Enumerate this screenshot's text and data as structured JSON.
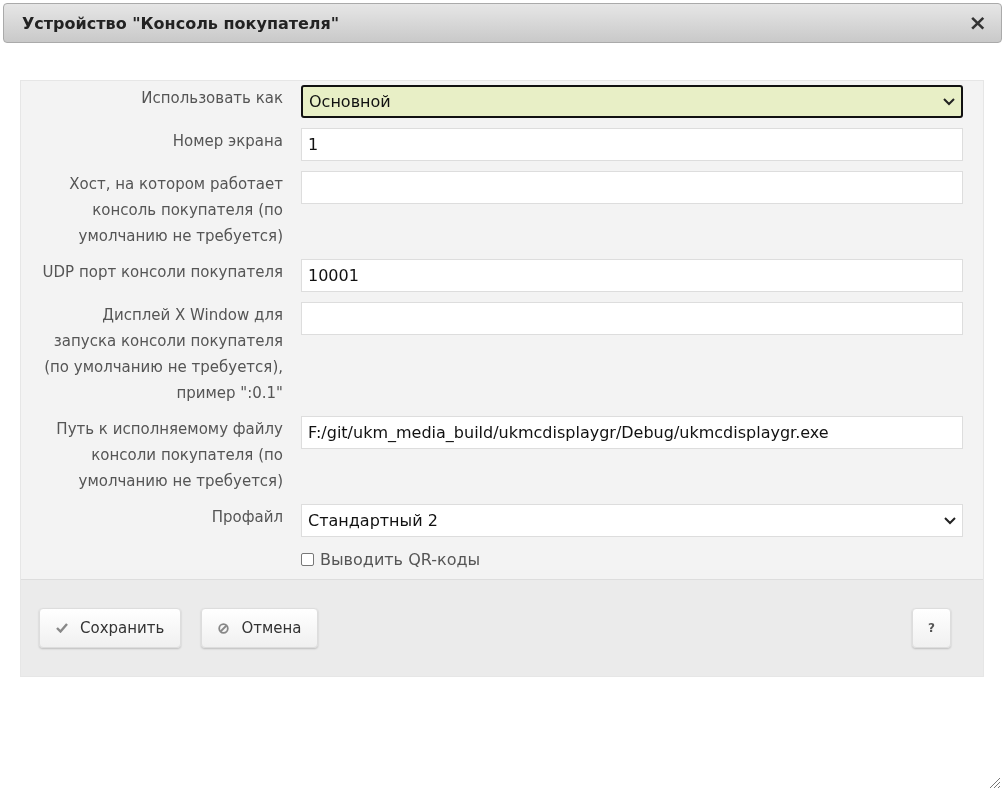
{
  "dialog": {
    "title": "Устройство \"Консоль покупателя\"",
    "close": "×"
  },
  "fields": [
    {
      "kind": "select",
      "label": "Использовать как",
      "value": "Основной",
      "focused": true
    },
    {
      "kind": "text",
      "label": "Номер экрана",
      "value": "1",
      "focused": false
    },
    {
      "kind": "text",
      "label": "Хост, на котором работает консоль покупателя (по умолчанию не требуется)",
      "focused": false
    },
    {
      "kind": "text",
      "label": "UDP порт консоли покупателя",
      "value": "10001",
      "focused": false
    },
    {
      "kind": "text",
      "label": "Дисплей X Window для запуска консоли покупателя (по умолчанию не требуется), пример \":0.1\"",
      "focused": false
    },
    {
      "kind": "text",
      "label": "Путь к исполняемому файлу консоли покупателя (по умолчанию не требуется)",
      "value": "F:/git/ukm_media_build/ukmcdisplaygr/Debug/ukmcdisplaygr.exe",
      "focused": false
    },
    {
      "kind": "select",
      "label": "Профайл",
      "value": "Стандартный 2",
      "focused": false
    },
    {
      "kind": "checkbox",
      "label": "Выводить QR-коды",
      "checked": false
    }
  ],
  "buttons": [
    {
      "kind": "save",
      "label": "Сохранить"
    },
    {
      "kind": "cancel",
      "label": "Отмена"
    }
  ],
  "help": "?"
}
